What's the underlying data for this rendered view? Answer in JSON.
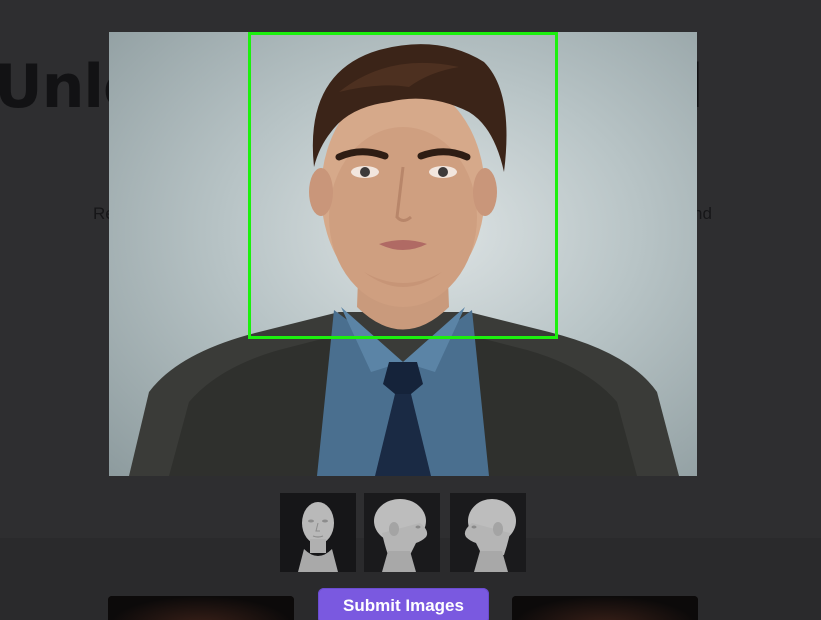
{
  "background": {
    "headline": "Unlock Your Potential",
    "subtext_left": "Re",
    "subtext_right": "nd"
  },
  "modal": {
    "preview_alt": "uploaded portrait",
    "face_box_color": "#1cf00e",
    "thumbnails": [
      {
        "name": "front",
        "icon": "head-front-icon"
      },
      {
        "name": "right-profile",
        "icon": "head-right-icon"
      },
      {
        "name": "left-profile",
        "icon": "head-left-icon"
      }
    ],
    "submit_label": "Submit Images"
  },
  "colors": {
    "overlay": "#2c2c2e",
    "accent": "#7a59e0",
    "detection": "#1cf00e"
  }
}
